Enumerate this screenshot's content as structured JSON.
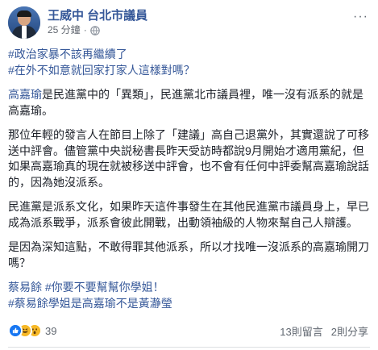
{
  "author": {
    "name": "王威中 台北市議員"
  },
  "post_meta": {
    "time": "25 分鐘"
  },
  "content": {
    "hashtags_top": [
      "#政治家暴不該再繼續了",
      "#在外不如意就回家打家人這樣對嗎？"
    ],
    "p1_name": "高嘉瑜",
    "p1_rest": "是民進黨中的「異類」，民進黨北市議員裡，唯一沒有派系的就是高嘉瑜。",
    "p2": "那位年輕的發言人在節目上除了「建議」高自己退黨外，其實還說了可移送中評會。儘管黨中央説秘書長昨天受訪時都說9月開始才適用黨紀，但如果高嘉瑜真的現在就被移送中評會，也不會有任何中評委幫高嘉瑜說話的，因為她沒派系。",
    "p3": "民進黨是派系文化，如果昨天這件事發生在其他民進黨市議員身上，早已成為派系戰爭，派系會彼此開戰，出動領袖級的人物來幫自己人辯護。",
    "p4": "是因為深知這點，不敢得罪其他派系，所以才找唯一沒派系的高嘉瑜開刀嗎？",
    "hashtags_bottom": [
      "蔡易餘 #你要不要幫幫你學姐！",
      "#蔡易餘學姐是高嘉瑜不是黃瀞瑩"
    ]
  },
  "footer": {
    "reaction_count": "39",
    "comments": "13則留言",
    "shares": "2則分享"
  },
  "colors": {
    "link": "#365899",
    "text": "#1d2129",
    "muted": "#616770"
  }
}
